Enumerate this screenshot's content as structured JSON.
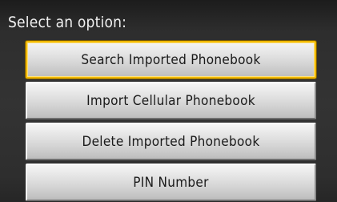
{
  "screen": {
    "title": "Select an option:"
  },
  "options": [
    {
      "label": "Search Imported Phonebook",
      "selected": true
    },
    {
      "label": "Import Cellular Phonebook",
      "selected": false
    },
    {
      "label": "Delete Imported Phonebook",
      "selected": false
    },
    {
      "label": "PIN Number",
      "selected": false
    }
  ],
  "colors": {
    "highlight": "#f0b800",
    "background": "#2e2e2e",
    "title_text": "#f2f2f2",
    "button_text": "#1a1a1a"
  }
}
